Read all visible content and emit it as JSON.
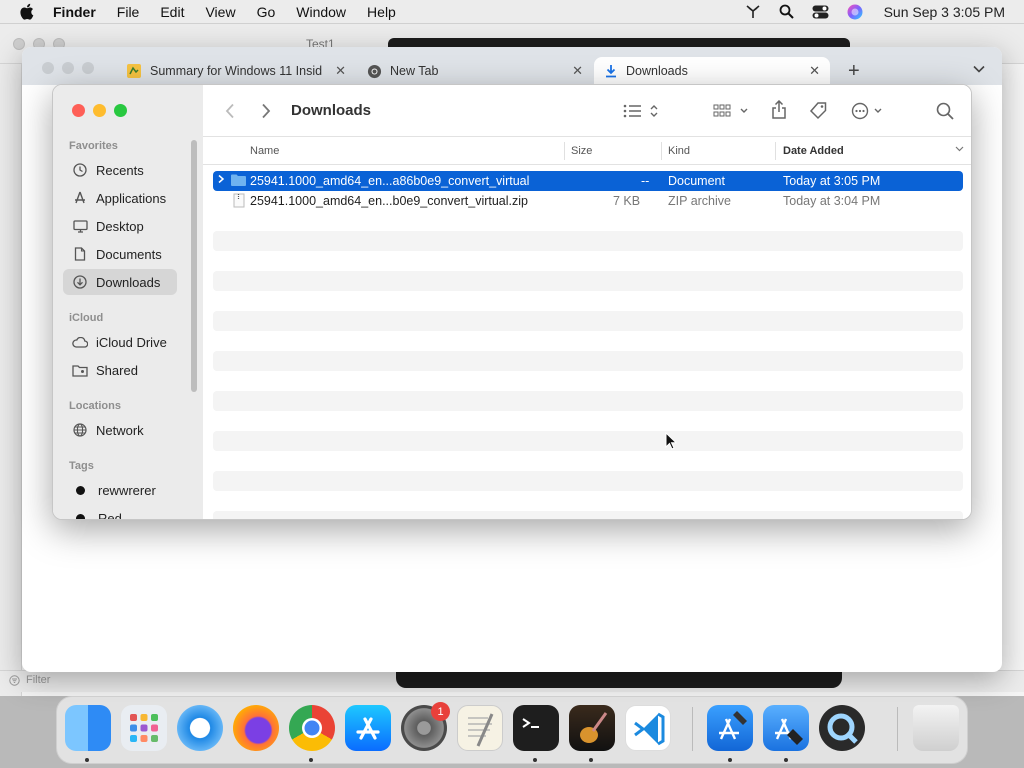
{
  "menubar": {
    "app": "Finder",
    "items": [
      "File",
      "Edit",
      "View",
      "Go",
      "Window",
      "Help"
    ],
    "clock": "Sun Sep 3  3:05 PM"
  },
  "background_window": {
    "tab_label": "Test1",
    "filter_placeholder": "Filter"
  },
  "chrome": {
    "tabs": [
      {
        "title": "Summary for Windows 11 Insid",
        "icon": "blog-icon"
      },
      {
        "title": "New Tab",
        "icon": "chrome-icon"
      },
      {
        "title": "Downloads",
        "icon": "download-icon",
        "active": true
      }
    ],
    "new_tab": "+",
    "close": "✕"
  },
  "finder": {
    "title": "Downloads",
    "sidebar": {
      "favorites_header": "Favorites",
      "favorites": [
        {
          "label": "Recents",
          "icon": "clock-icon"
        },
        {
          "label": "Applications",
          "icon": "applications-icon"
        },
        {
          "label": "Desktop",
          "icon": "desktop-icon"
        },
        {
          "label": "Documents",
          "icon": "document-icon"
        },
        {
          "label": "Downloads",
          "icon": "download-icon",
          "selected": true
        }
      ],
      "icloud_header": "iCloud",
      "icloud": [
        {
          "label": "iCloud Drive",
          "icon": "cloud-icon"
        },
        {
          "label": "Shared",
          "icon": "shared-folder-icon"
        }
      ],
      "locations_header": "Locations",
      "locations": [
        {
          "label": "Network",
          "icon": "globe-icon"
        }
      ],
      "tags_header": "Tags",
      "tags": [
        {
          "label": "rewwrerer",
          "color": "#111111"
        },
        {
          "label": "Red",
          "color": "#111111"
        }
      ]
    },
    "columns": {
      "name": "Name",
      "size": "Size",
      "kind": "Kind",
      "date": "Date Added"
    },
    "rows": [
      {
        "name": "25941.1000_amd64_en...a86b0e9_convert_virtual",
        "size": "--",
        "kind": "Document",
        "date": "Today at 3:05 PM",
        "selected": true,
        "type": "folder"
      },
      {
        "name": "25941.1000_amd64_en...b0e9_convert_virtual.zip",
        "size": "7 KB",
        "kind": "ZIP archive",
        "date": "Today at 3:04 PM",
        "selected": false,
        "type": "zip"
      }
    ]
  },
  "dock": {
    "apps": [
      "Finder",
      "Launchpad",
      "Safari",
      "Firefox",
      "Chrome",
      "App Store",
      "System Settings",
      "TextEdit",
      "Terminal",
      "GarageBand",
      "VS Code",
      "Xcode",
      "Xcode Instruments",
      "QuickTime",
      "Trash"
    ],
    "system_settings_badge": "1"
  },
  "colors": {
    "selection": "#0a62d6",
    "close": "#fe5f57",
    "minimize": "#febc2e",
    "zoom": "#28c840"
  }
}
